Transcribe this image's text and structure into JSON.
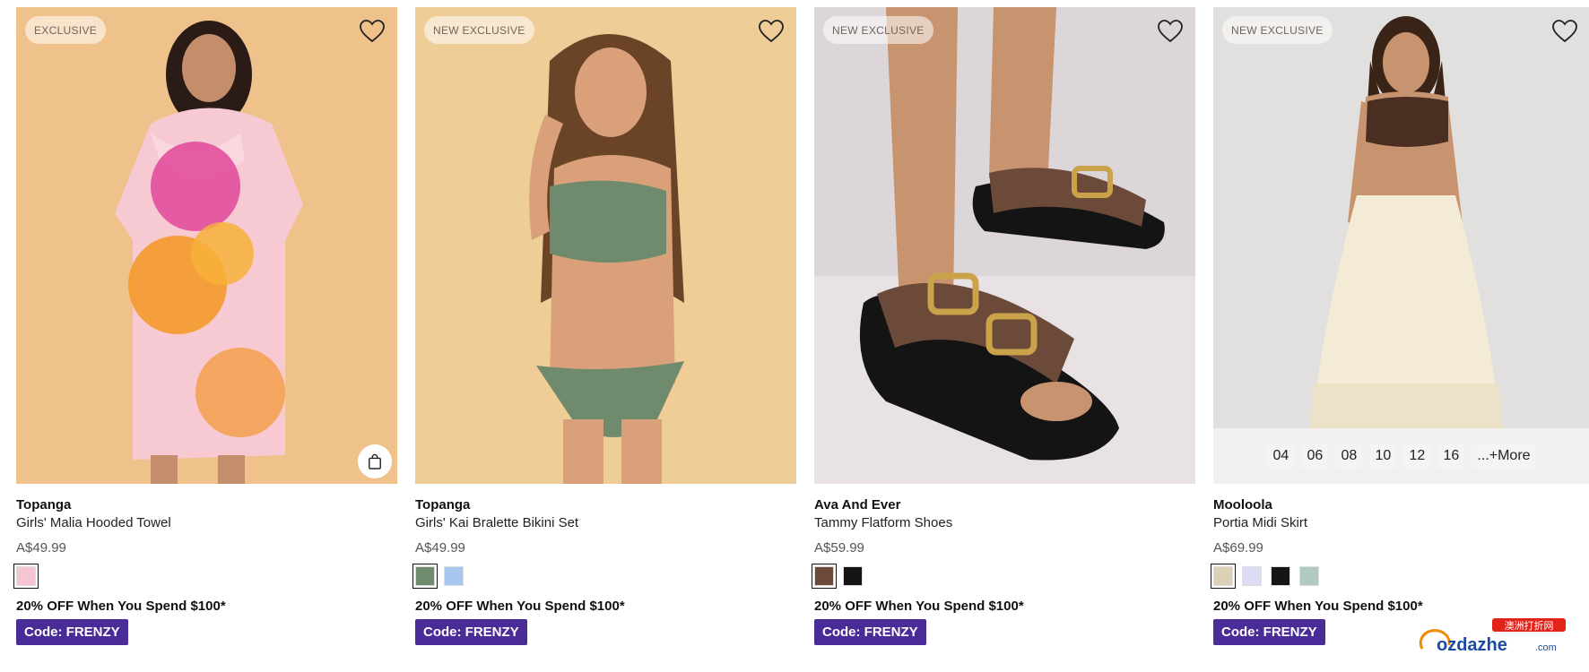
{
  "products": [
    {
      "badge": "EXCLUSIVE",
      "brand": "Topanga",
      "name": "Girls' Malia Hooded Towel",
      "price": "A$49.99",
      "swatches": [
        "#f6c5d2"
      ],
      "promo": "20% OFF When You Spend $100*",
      "code": "Code: FRENZY",
      "quick_add": true,
      "sizes": []
    },
    {
      "badge": "NEW EXCLUSIVE",
      "brand": "Topanga",
      "name": "Girls' Kai Bralette Bikini Set",
      "price": "A$49.99",
      "swatches": [
        "#6f8a6c",
        "#a7c7ef"
      ],
      "promo": "20% OFF When You Spend $100*",
      "code": "Code: FRENZY",
      "quick_add": false,
      "sizes": []
    },
    {
      "badge": "NEW EXCLUSIVE",
      "brand": "Ava And Ever",
      "name": "Tammy Flatform Shoes",
      "price": "A$59.99",
      "swatches": [
        "#6b4a3a",
        "#141414"
      ],
      "promo": "20% OFF When You Spend $100*",
      "code": "Code: FRENZY",
      "quick_add": false,
      "sizes": []
    },
    {
      "badge": "NEW EXCLUSIVE",
      "brand": "Mooloola",
      "name": "Portia Midi Skirt",
      "price": "A$69.99",
      "swatches": [
        "#dcd1b7",
        "#dcdcf2",
        "#151515",
        "#b1c9c0"
      ],
      "promo": "20% OFF When You Spend $100*",
      "code": "Code: FRENZY",
      "quick_add": false,
      "sizes": [
        "04",
        "06",
        "08",
        "10",
        "12",
        "16",
        "...+More"
      ]
    }
  ],
  "watermark": {
    "cn": "澳洲打折网",
    "latin": "ozdazhe",
    "suffix": ".com"
  },
  "colors": {
    "promo_bg": "#4a2c98"
  },
  "icons": {
    "wishlist": "heart-icon",
    "quick_add": "shopping-bag-icon"
  }
}
